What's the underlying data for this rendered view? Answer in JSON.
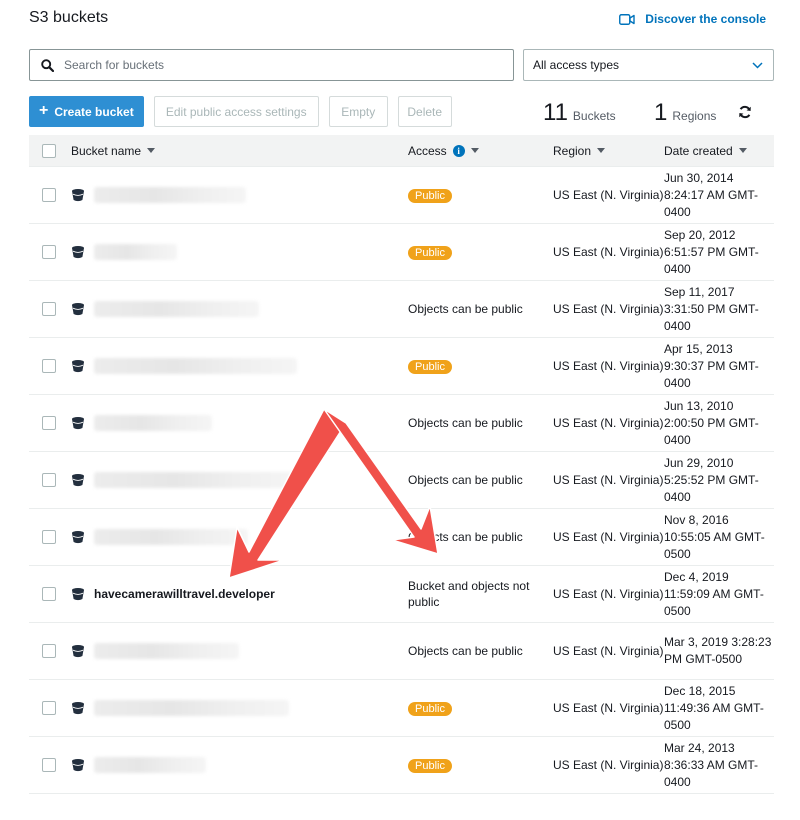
{
  "header": {
    "title": "S3 buckets",
    "discover_label": "Discover the console"
  },
  "search": {
    "placeholder": "Search for buckets",
    "value": ""
  },
  "filter": {
    "selected": "All access types"
  },
  "toolbar": {
    "create_label": "Create bucket",
    "edit_public_label": "Edit public access settings",
    "empty_label": "Empty",
    "delete_label": "Delete"
  },
  "stats": {
    "buckets_count": "11",
    "buckets_label": "Buckets",
    "regions_count": "1",
    "regions_label": "Regions"
  },
  "table": {
    "columns": {
      "name": "Bucket name",
      "access": "Access",
      "region": "Region",
      "date": "Date created"
    },
    "rows": [
      {
        "name": "",
        "access": "Public",
        "access_type": "public",
        "region": "US East (N. Virginia)",
        "date": "Jun 30, 2014 8:24:17 AM GMT-0400"
      },
      {
        "name": "",
        "access": "Public",
        "access_type": "public",
        "region": "US East (N. Virginia)",
        "date": "Sep 20, 2012 6:51:57 PM GMT-0400"
      },
      {
        "name": "",
        "access": "Objects can be public",
        "access_type": "text",
        "region": "US East (N. Virginia)",
        "date": "Sep 11, 2017 3:31:50 PM GMT-0400"
      },
      {
        "name": "",
        "access": "Public",
        "access_type": "public",
        "region": "US East (N. Virginia)",
        "date": "Apr 15, 2013 9:30:37 PM GMT-0400"
      },
      {
        "name": "",
        "access": "Objects can be public",
        "access_type": "text",
        "region": "US East (N. Virginia)",
        "date": "Jun 13, 2010 2:00:50 PM GMT-0400"
      },
      {
        "name": "",
        "access": "Objects can be public",
        "access_type": "text",
        "region": "US East (N. Virginia)",
        "date": "Jun 29, 2010 5:25:52 PM GMT-0400"
      },
      {
        "name": "",
        "access": "Objects can be public",
        "access_type": "text",
        "region": "US East (N. Virginia)",
        "date": "Nov 8, 2016 10:55:05 AM GMT-0500"
      },
      {
        "name": "havecamerawilltravel.developer",
        "access": "Bucket and objects not public",
        "access_type": "text",
        "region": "US East (N. Virginia)",
        "date": "Dec 4, 2019 11:59:09 AM GMT-0500"
      },
      {
        "name": "",
        "access": "Objects can be public",
        "access_type": "text",
        "region": "US East (N. Virginia)",
        "date": "Mar 3, 2019 3:28:23 PM GMT-0500"
      },
      {
        "name": "",
        "access": "Public",
        "access_type": "public",
        "region": "US East (N. Virginia)",
        "date": "Dec 18, 2015 11:49:36 AM GMT-0500"
      },
      {
        "name": "",
        "access": "Public",
        "access_type": "public",
        "region": "US East (N. Virginia)",
        "date": "Mar 24, 2013 8:36:33 AM GMT-0400"
      }
    ]
  },
  "colors": {
    "primary_button": "#2e8fd3",
    "link": "#0073bb",
    "public_badge": "#f0a21a",
    "annotation_arrow": "#f0504a"
  },
  "icons": {
    "search": "search-icon",
    "video": "video-camera-icon",
    "dropdown": "chevron-down-icon",
    "refresh": "refresh-icon",
    "bucket": "bucket-icon",
    "info": "info-icon"
  }
}
